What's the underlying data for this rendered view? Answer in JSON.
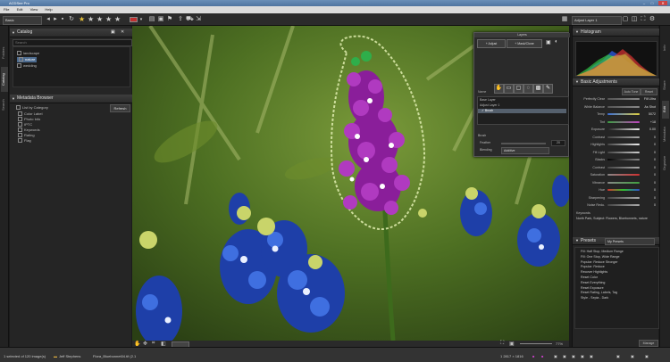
{
  "window": {
    "title": "ACDSee Pro"
  },
  "menu": [
    "File",
    "Edit",
    "View",
    "Help"
  ],
  "toolbar": {
    "mode": "Basic",
    "rating": 1,
    "max_rating": 5,
    "colors": {
      "label": "#c03030"
    },
    "workspace": "Adjust Layer 1"
  },
  "left_tabs": [
    "Folders",
    "Catalog",
    "Search"
  ],
  "catalog": {
    "title": "Catalog",
    "search_placeholder": "Search",
    "items": [
      {
        "label": "landscape",
        "selected": false
      },
      {
        "label": "nature",
        "selected": true
      },
      {
        "label": "wedding",
        "selected": false
      }
    ]
  },
  "metadata": {
    "title": "Metadata Browser",
    "refresh_label": "Refresh",
    "items": [
      "List by Category",
      "Color Label",
      "Photo Info",
      "IPTC",
      "Keywords",
      "Rating",
      "Flag"
    ]
  },
  "layers": {
    "title": "Layers",
    "btn_adjust": "+ Adjust",
    "btn_mask": "+ Mask/Clone",
    "name_label": "Name",
    "items": [
      {
        "label": "Base Layer",
        "selected": false
      },
      {
        "label": "Adjust Layer 1",
        "selected": false
      },
      {
        "label": "✓ Brush",
        "selected": true
      }
    ],
    "section": "Brush",
    "feather_label": "Feather",
    "feather_value": "20",
    "blend_label": "Blending",
    "blend_value": "Additive"
  },
  "right_tabs": [
    "Info",
    "Share",
    "Edit",
    "Metadata",
    "Organize"
  ],
  "histogram": {
    "title": "Histogram"
  },
  "basic_adjustments": {
    "title": "Basic Adjustments",
    "preset_label": "Auto Tone",
    "reset_label": "Reset",
    "rows": [
      {
        "label": "Perfectly Clear",
        "value": "Fill Ultra"
      },
      {
        "label": "White Balance",
        "value": "As Shot"
      },
      {
        "label": "Temp",
        "value": "5072"
      },
      {
        "label": "Tint",
        "value": "+18"
      },
      {
        "label": "Exposure",
        "value": "0.00"
      },
      {
        "label": "Contrast",
        "value": "0"
      },
      {
        "label": "Highlights",
        "value": "0"
      },
      {
        "label": "Fill Light",
        "value": "0"
      },
      {
        "label": "Blacks",
        "value": "0"
      },
      {
        "label": "Contrast",
        "value": "0"
      },
      {
        "label": "Saturation",
        "value": "0"
      },
      {
        "label": "Vibrance",
        "value": "0"
      },
      {
        "label": "Hue",
        "value": "0"
      },
      {
        "label": "Sharpening",
        "value": "0"
      },
      {
        "label": "Noise Redu.",
        "value": "0"
      }
    ],
    "keywords_label": "Keywords",
    "keywords_text": "North Park, Subject: Flowers, Bluebonnets, nature"
  },
  "presets": {
    "title": "Presets",
    "selected": "My Presets",
    "items": [
      "Fill: Half Stop, Medium Range",
      "Fill: One Stop, Wide Range",
      "Popular: Reduce Stronger",
      "Popular: Reduce",
      "Recover Highlights",
      "Reset Color",
      "Reset Everything",
      "Reset Exposure",
      "Reset Rating, Labels, Tag",
      "Style - Sepia - Dark"
    ],
    "manage_label": "Manage"
  },
  "bottom": {
    "zoom": "77%"
  },
  "status": {
    "count": "1 selected of 120 image(s)",
    "folder": "Jeff Stephens",
    "file": "Flora_Bluebonnet04.tif (2.1",
    "dims": "1 2817 × 1816"
  }
}
